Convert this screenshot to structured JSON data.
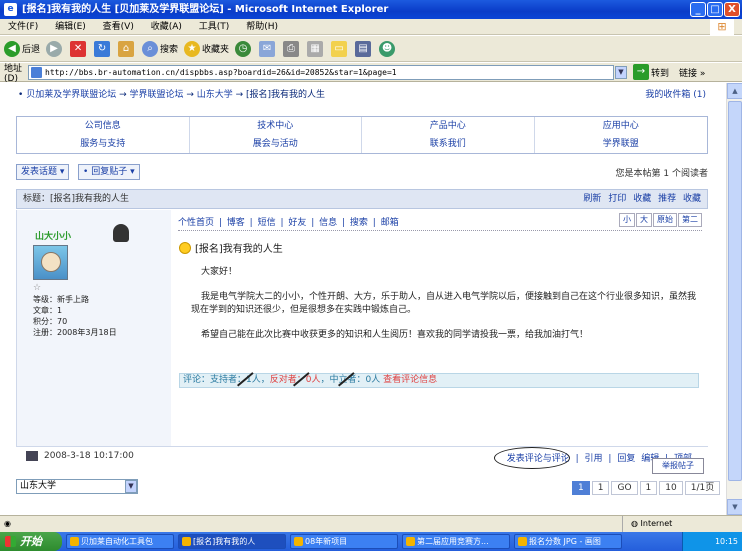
{
  "window": {
    "title": "[报名]我有我的人生 [贝加莱及学界联盟论坛] - Microsoft Internet Explorer",
    "controls": [
      "_",
      "□",
      "X"
    ]
  },
  "menu": [
    "文件(F)",
    "编辑(E)",
    "查看(V)",
    "收藏(A)",
    "工具(T)",
    "帮助(H)"
  ],
  "toolbar": {
    "back": "后退",
    "search": "搜索",
    "favorites": "收藏夹"
  },
  "address": {
    "label": "地址(D)",
    "url": "http://bbs.br-automation.cn/dispbbs.asp?boardid=26&id=20852&star=1&page=1",
    "go": "转到",
    "links": "链接 »"
  },
  "forum": {
    "breadcrumb": [
      "贝加莱及学界联盟论坛",
      "学界联盟论坛",
      "山东大学",
      "[报名]我有我的人生"
    ],
    "inbox": "我的收件箱 (1)",
    "nav_links": [
      "公司信息",
      "技术中心",
      "产品中心",
      "应用中心",
      "服务与支持",
      "展会与活动",
      "联系我们",
      "学界联盟"
    ],
    "buttons": {
      "new_post": "发表话题",
      "reply": "回复贴子"
    },
    "online": "您是本帖第 1 个阅读者",
    "topic": "标题：[报名]我有我的人生",
    "topic_tools": [
      "刷新",
      "打印",
      "收藏",
      "推荐",
      "收藏"
    ],
    "user": {
      "name": "山大小小",
      "level_star": "☆",
      "info": [
        "等级：新手上路",
        "文章：1",
        "积分：70",
        "注册：2008年3月18日"
      ]
    },
    "post_tabs": [
      "个性首页",
      "博客",
      "短信",
      "好友",
      "信息",
      "搜索",
      "邮箱"
    ],
    "font_size": [
      "小",
      "大",
      "原始",
      "第二"
    ],
    "post_title": "[报名]我有我的人生",
    "body": [
      "大家好！",
      "我是电气学院大二的小小，个性开朗、大方，乐于助人，自从进入电气学院以后，便接触到自己在这个行业很多知识，虽然我现在学到的知识还很少，但是很想多在实践中锻炼自己。",
      "希望自己能在此次比赛中收获更多的知识和人生阅历！喜欢我的同学请投我一票，给我加油打气！"
    ],
    "rating": {
      "prefix": "评论：",
      "support": "支持者：1人",
      "neutral": "中立者：0人",
      "oppose": "反对者：0人",
      "link": "查看评论信息"
    },
    "post_time": "2008-3-18 10:17:00",
    "post_actions": [
      "发表评论与评论",
      "引用",
      "回复",
      "编辑",
      "顶部"
    ],
    "tooltip": "举报帖子",
    "forum_select": "山东大学",
    "pager": [
      "1",
      "1",
      "GO",
      "1",
      "10",
      "1/1页"
    ]
  },
  "statusbar": {
    "zone": "Internet"
  },
  "taskbar": {
    "start": "开始",
    "tasks": [
      "贝加莱自动化工具包",
      "[报名]我有我的人",
      "08年新项目",
      "第二届应用竞赛方...",
      "报名分数 JPG - 画图"
    ],
    "clock": "10:15"
  },
  "colors": {
    "accent": "#1a3fa6",
    "title_bar": "#0a3cc8",
    "support": "#2a7aa0",
    "oppose": "#e04040"
  }
}
